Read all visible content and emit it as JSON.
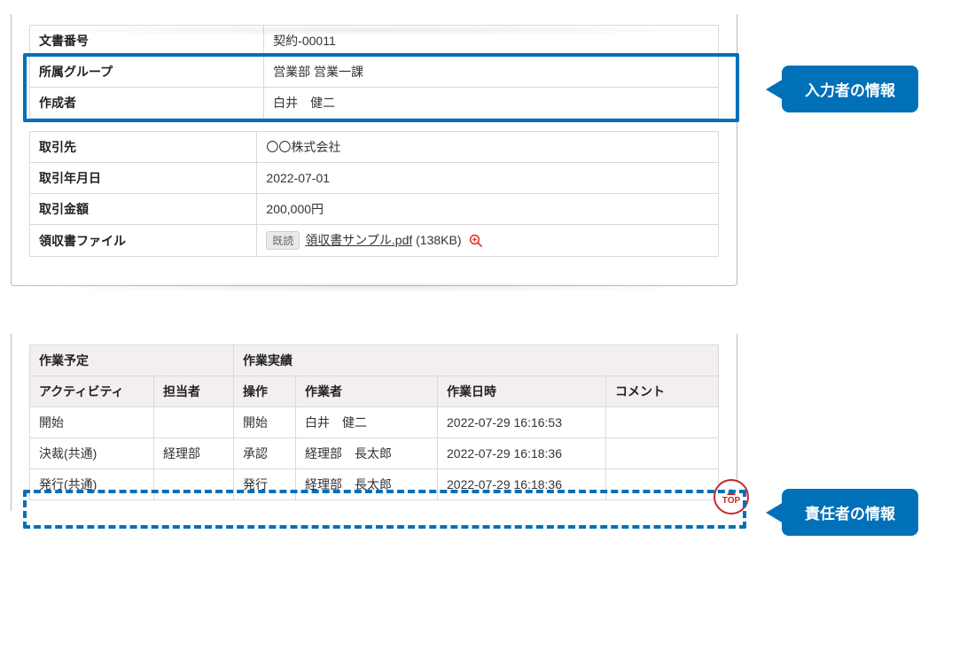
{
  "doc_table": {
    "rows": [
      {
        "label": "文書番号",
        "value": "契約-00011"
      },
      {
        "label": "所属グループ",
        "value": "営業部 営業一課"
      },
      {
        "label": "作成者",
        "value": "白井　健二"
      }
    ]
  },
  "deal_table": {
    "rows": [
      {
        "label": "取引先",
        "value": "〇〇株式会社"
      },
      {
        "label": "取引年月日",
        "value": "2022-07-01"
      },
      {
        "label": "取引金額",
        "value": "200,000円"
      }
    ],
    "file_row": {
      "label": "領収書ファイル",
      "badge": "既読",
      "filename": "領収書サンプル.pdf",
      "filesize": "(138KB)"
    }
  },
  "work_table": {
    "head_planned": "作業予定",
    "head_actual": "作業実績",
    "cols_planned": [
      "アクティビティ",
      "担当者"
    ],
    "cols_actual": [
      "操作",
      "作業者",
      "作業日時",
      "コメント"
    ],
    "rows": [
      {
        "activity": "開始",
        "assignee": "",
        "op": "開始",
        "worker": "白井　健二",
        "datetime": "2022-07-29 16:16:53",
        "comment": ""
      },
      {
        "activity": "決裁(共通)",
        "assignee": "経理部",
        "op": "承認",
        "worker": "経理部　長太郎",
        "datetime": "2022-07-29 16:18:36",
        "comment": ""
      },
      {
        "activity": "発行(共通)",
        "assignee": "",
        "op": "発行",
        "worker": "経理部　長太郎",
        "datetime": "2022-07-29 16:18:36",
        "comment": ""
      }
    ]
  },
  "callouts": {
    "input_person": "入力者の情報",
    "responsible_person": "責任者の情報"
  },
  "top_button": "TOP"
}
